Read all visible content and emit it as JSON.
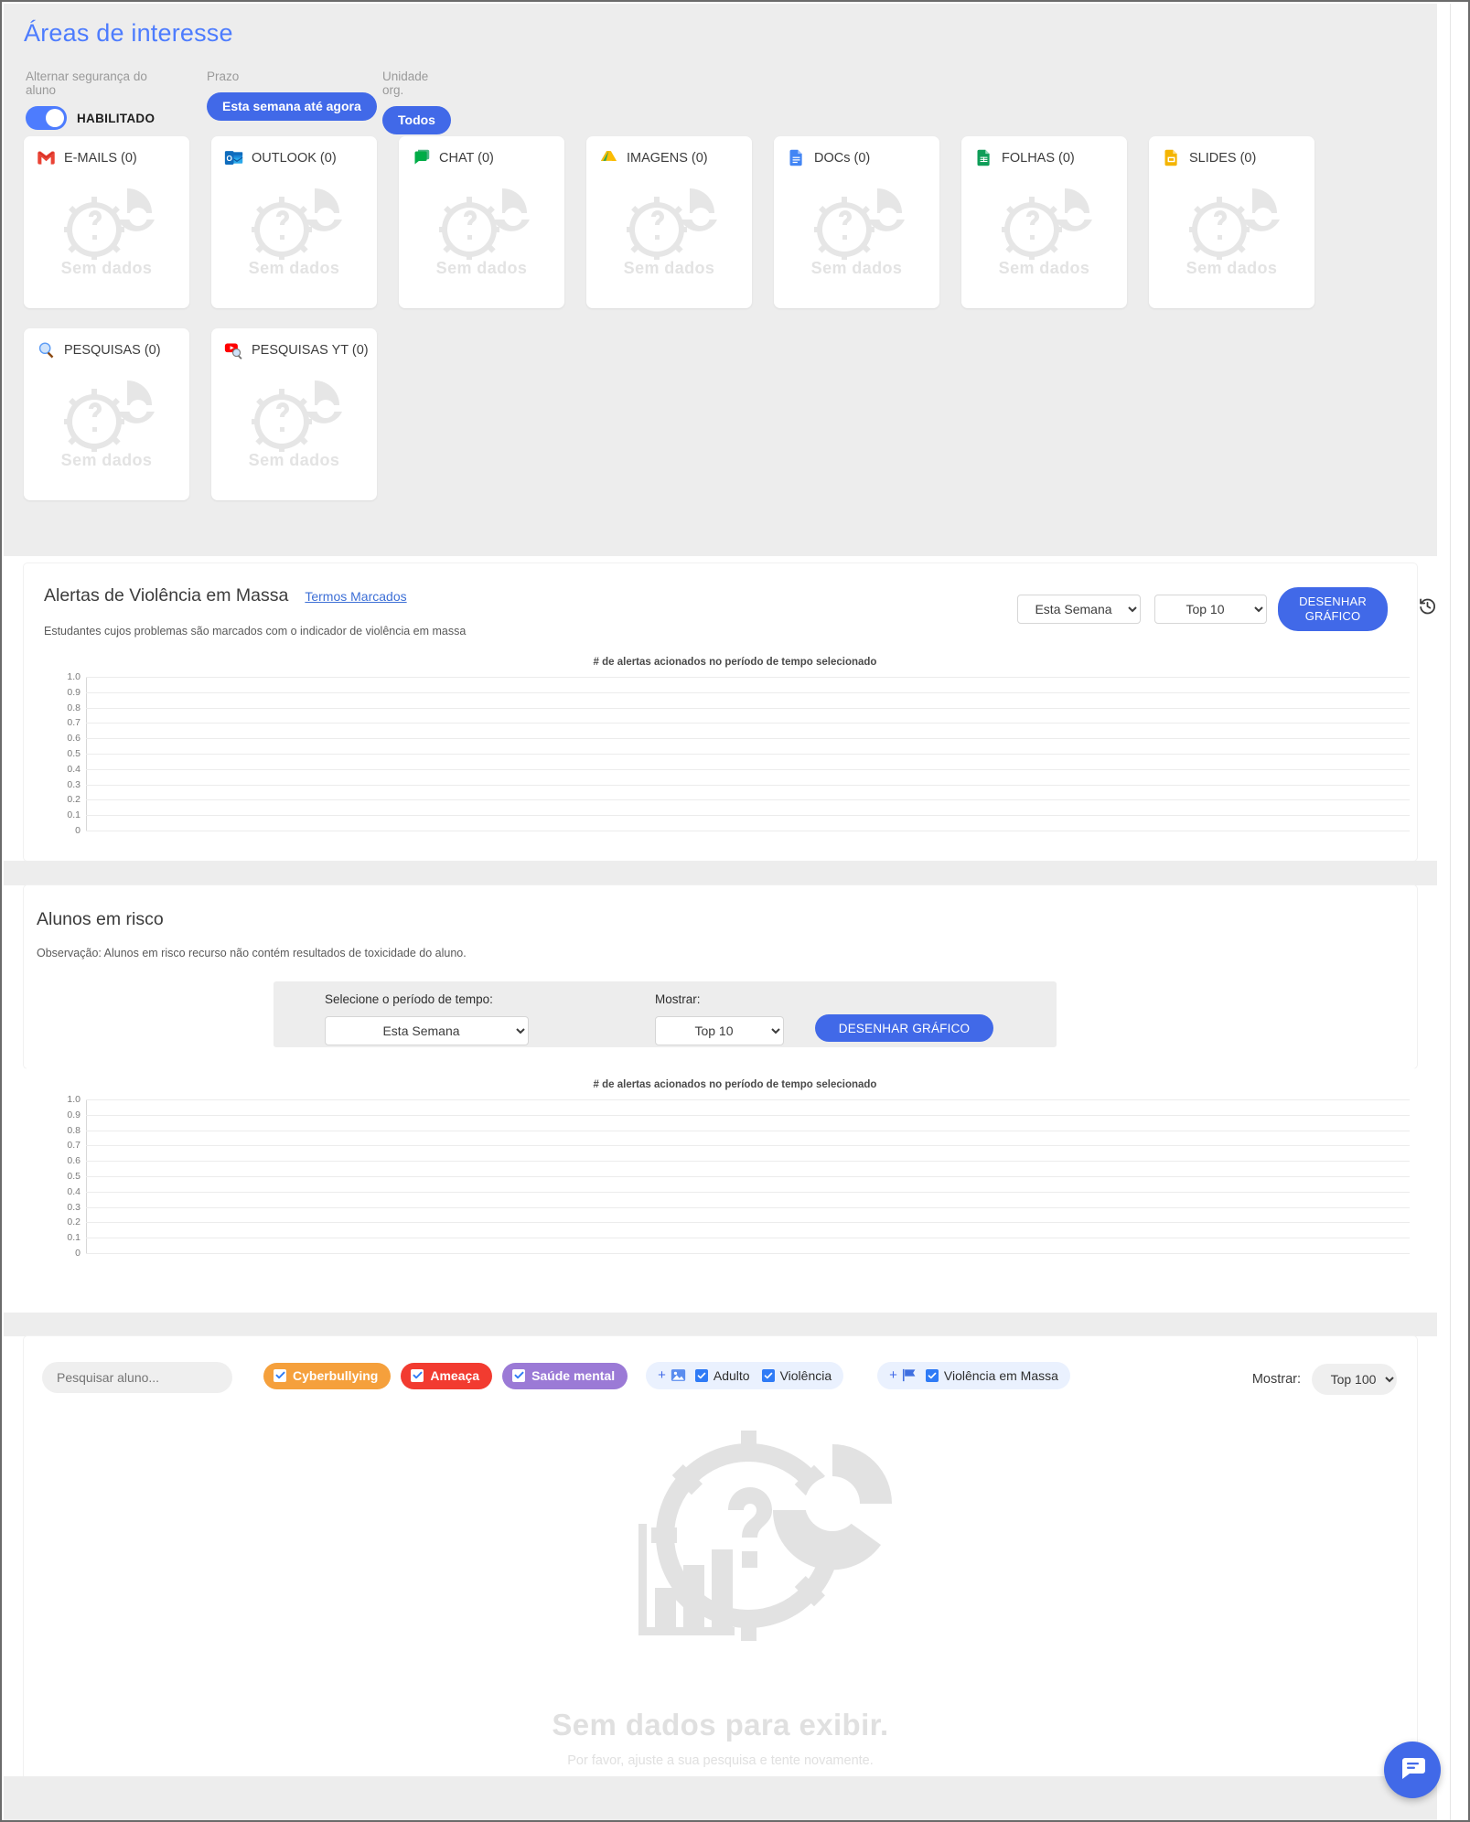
{
  "header": {
    "title": "Áreas de interesse",
    "filters": [
      {
        "label": "Alternar segurança do aluno",
        "type": "toggle",
        "value": "HABILITADO",
        "enabled": true
      },
      {
        "label": "Prazo",
        "type": "pill",
        "value": "Esta semana até agora"
      },
      {
        "label": "Unidade org.",
        "type": "pill",
        "value": "Todos"
      }
    ]
  },
  "source_cards": [
    {
      "icon": "gmail-icon",
      "title": "E-MAILS (0)",
      "empty": "Sem dados"
    },
    {
      "icon": "outlook-icon",
      "title": "OUTLOOK (0)",
      "empty": "Sem dados"
    },
    {
      "icon": "google-chat-icon",
      "title": "CHAT (0)",
      "empty": "Sem dados"
    },
    {
      "icon": "google-drive-icon",
      "title": "IMAGENS (0)",
      "empty": "Sem dados"
    },
    {
      "icon": "google-docs-icon",
      "title": "DOCs (0)",
      "empty": "Sem dados"
    },
    {
      "icon": "google-sheets-icon",
      "title": "FOLHAS (0)",
      "empty": "Sem dados"
    },
    {
      "icon": "google-slides-icon",
      "title": "SLIDES (0)",
      "empty": "Sem dados"
    },
    {
      "icon": "search-icon",
      "title": "PESQUISAS (0)",
      "empty": "Sem dados"
    },
    {
      "icon": "youtube-search-icon",
      "title": "PESQUISAS YT (0)",
      "empty": "Sem dados"
    }
  ],
  "mass_violence": {
    "title": "Alertas de Violência em Massa",
    "link": "Termos Marcados",
    "subtitle": "Estudantes cujos problemas são marcados com o indicador de violência em massa",
    "period_select": {
      "value": "Esta Semana",
      "options": [
        "Esta Semana"
      ]
    },
    "top_select": {
      "value": "Top 10",
      "options": [
        "Top 10"
      ]
    },
    "draw_button": "DESENHAR GRÁFICO",
    "reset_icon": "history-reset-icon"
  },
  "at_risk": {
    "title": "Alunos em risco",
    "subtitle": "Observação: Alunos em risco recurso não contém resultados de toxicidade do aluno.",
    "period_label": "Selecione o período de tempo:",
    "show_label": "Mostrar:",
    "period_select": {
      "value": "Esta Semana",
      "options": [
        "Esta Semana"
      ]
    },
    "top_select": {
      "value": "Top 10",
      "options": [
        "Top 10"
      ]
    },
    "draw_button": "DESENHAR GRÁFICO"
  },
  "student_list": {
    "search_placeholder": "Pesquisar aluno...",
    "tags": [
      {
        "label": "Cyberbullying",
        "color": "#f5a03c",
        "checked": true
      },
      {
        "label": "Ameaça",
        "color": "#f23b30",
        "checked": true
      },
      {
        "label": "Saúde mental",
        "color": "#9b7ad6",
        "checked": true
      }
    ],
    "groups": [
      {
        "icon": "image-icon",
        "plus": "+",
        "options": [
          {
            "label": "Adulto",
            "checked": true
          },
          {
            "label": "Violência",
            "checked": true
          }
        ]
      },
      {
        "icon": "flag-icon",
        "plus": "+",
        "options": [
          {
            "label": "Violência em Massa",
            "checked": true
          }
        ]
      }
    ],
    "show_label": "Mostrar:",
    "top_select": {
      "value": "Top 100",
      "options": [
        "Top 100"
      ]
    },
    "empty_title": "Sem dados para exibir.",
    "empty_sub": "Por favor, ajuste a sua pesquisa e tente novamente.",
    "empty_icon": "no-data-chart-icon"
  },
  "chat_widget": {
    "icon": "chat-bubble-icon"
  },
  "colors": {
    "accent": "#4169e8",
    "title": "#4d7cfe",
    "panel_bg": "#ededed",
    "card_bg": "#ffffff",
    "muted": "#9a9a9a"
  },
  "chart_data": [
    {
      "type": "bar",
      "title": "# de alertas acionados no período de tempo selecionado",
      "section": "Alertas de Violência em Massa",
      "categories": [],
      "values": [],
      "xlabel": "",
      "ylabel": "",
      "ylim": [
        0,
        1.0
      ],
      "yticks": [
        "1.0",
        "0.9",
        "0.8",
        "0.7",
        "0.6",
        "0.5",
        "0.4",
        "0.3",
        "0.2",
        "0.1",
        "0"
      ],
      "grid": true,
      "legend": "none",
      "empty": true
    },
    {
      "type": "bar",
      "title": "# de alertas acionados no período de tempo selecionado",
      "section": "Alunos em risco",
      "categories": [],
      "values": [],
      "xlabel": "",
      "ylabel": "",
      "ylim": [
        0,
        1.0
      ],
      "yticks": [
        "1.0",
        "0.9",
        "0.8",
        "0.7",
        "0.6",
        "0.5",
        "0.4",
        "0.3",
        "0.2",
        "0.1",
        "0"
      ],
      "grid": true,
      "legend": "none",
      "empty": true
    }
  ]
}
